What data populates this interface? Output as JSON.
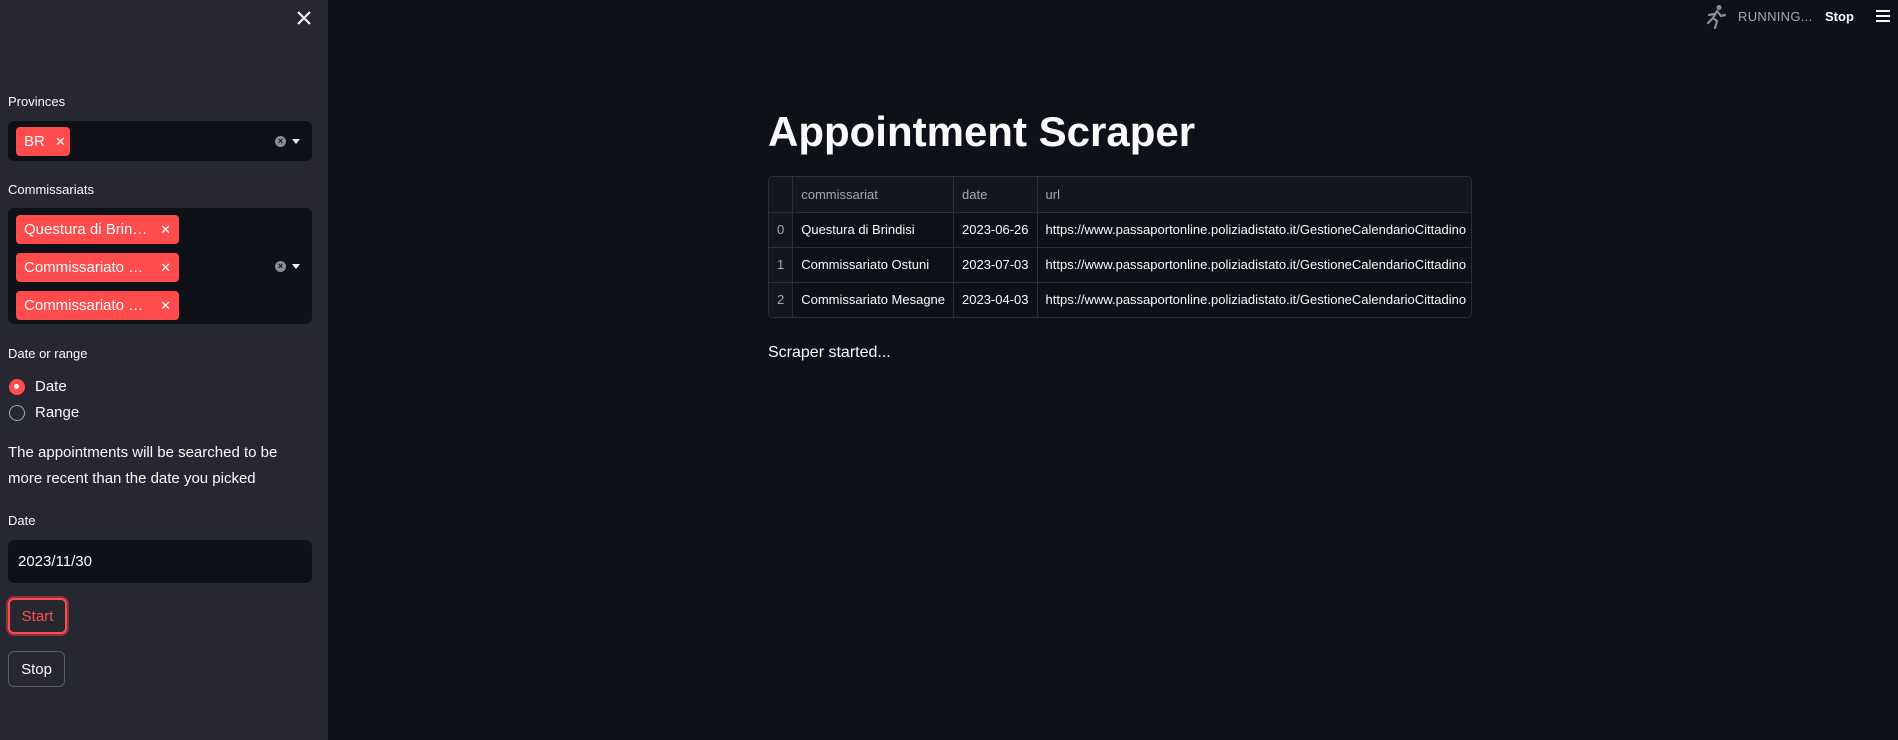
{
  "sidebar": {
    "provinces_label": "Provinces",
    "provinces": [
      "BR"
    ],
    "commissariats_label": "Commissariats",
    "commissariats": [
      "Questura di Brin…",
      "Commissariato …",
      "Commissariato …"
    ],
    "date_or_range_label": "Date or range",
    "radio_options": [
      {
        "label": "Date",
        "checked": true
      },
      {
        "label": "Range",
        "checked": false
      }
    ],
    "info_text": "The appointments will be searched to be more recent than the date you picked",
    "date_label": "Date",
    "date_value": "2023/11/30",
    "start_label": "Start",
    "stop_label": "Stop"
  },
  "topbar": {
    "running_text": "RUNNING...",
    "stop_label": "Stop"
  },
  "main": {
    "title": "Appointment Scraper",
    "table": {
      "columns": [
        "",
        "commissariat",
        "date",
        "url"
      ],
      "rows": [
        {
          "index": "0",
          "commissariat": "Questura di Brindisi",
          "date": "2023-06-26",
          "url": "https://www.passaportonline.poliziadistato.it/GestioneCalendarioCittadino"
        },
        {
          "index": "1",
          "commissariat": "Commissariato Ostuni",
          "date": "2023-07-03",
          "url": "https://www.passaportonline.poliziadistato.it/GestioneCalendarioCittadino"
        },
        {
          "index": "2",
          "commissariat": "Commissariato Mesagne",
          "date": "2023-04-03",
          "url": "https://www.passaportonline.poliziadistato.it/GestioneCalendarioCittadino"
        }
      ]
    },
    "status": "Scraper started..."
  },
  "colors": {
    "accent": "#ff4b4b",
    "background": "#0e1117",
    "sidebar": "#262730"
  }
}
